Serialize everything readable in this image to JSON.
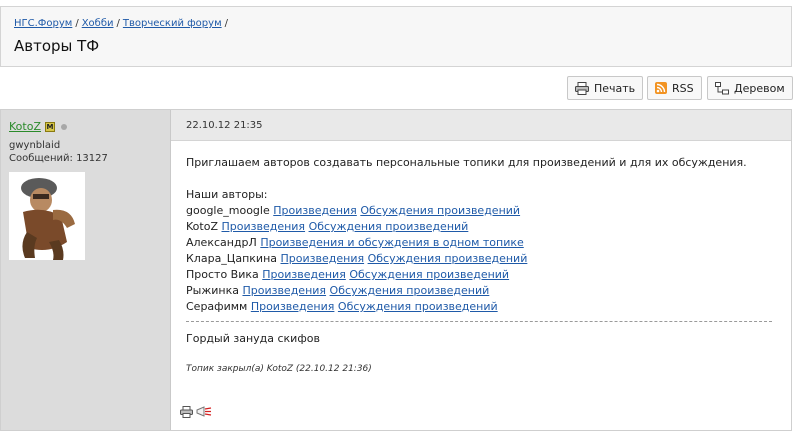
{
  "breadcrumb": {
    "items": [
      "НГС.Форум",
      "Хобби",
      "Творческий форум"
    ],
    "separator": "/"
  },
  "page": {
    "title": "Авторы ТФ"
  },
  "toolbar": {
    "print_label": "Печать",
    "rss_label": "RSS",
    "tree_label": "Деревом"
  },
  "post": {
    "date": "22.10.12 21:35",
    "author": {
      "name": "KotoZ",
      "badge": "М",
      "user_title": "gwynblaid",
      "messages_label": "Сообщений:",
      "messages_count": "13127"
    },
    "intro": "Приглашаем авторов создавать персональные топики для произведений и для их обсуждения.",
    "authors_heading": "Наши авторы:",
    "authors": [
      {
        "name": "google_moogle",
        "links": [
          "Произведения",
          "Обсуждения произведений"
        ]
      },
      {
        "name": "KotoZ",
        "links": [
          "Произведения",
          "Обсуждения произведений"
        ]
      },
      {
        "name": "АлександрЛ",
        "links": [
          "Произведения и обсуждения в одном топике"
        ]
      },
      {
        "name": "Клара_Цапкина",
        "links": [
          "Произведения",
          "Обсуждения произведений"
        ]
      },
      {
        "name": "Просто Вика",
        "links": [
          "Произведения",
          "Обсуждения произведений"
        ]
      },
      {
        "name": "Рыжинка",
        "links": [
          "Произведения",
          "Обсуждения произведений"
        ]
      },
      {
        "name": "Серафимм",
        "links": [
          "Произведения",
          "Обсуждения произведений"
        ]
      }
    ],
    "signature": "Гордый зануда скифов",
    "closed_note": "Топик закрыл(а) KotoZ (22.10.12 21:36)"
  },
  "icons": {
    "print": "printer-icon",
    "rss": "rss-icon",
    "tree": "tree-icon",
    "status": "offline-status-icon",
    "report": "complaint-icon"
  },
  "colors": {
    "link": "#1f5aa8",
    "author_name": "#2a8a2a",
    "sidebar_bg": "#dcdcdc",
    "date_bar_bg": "#e9e9e9",
    "rss": "#f29322"
  }
}
